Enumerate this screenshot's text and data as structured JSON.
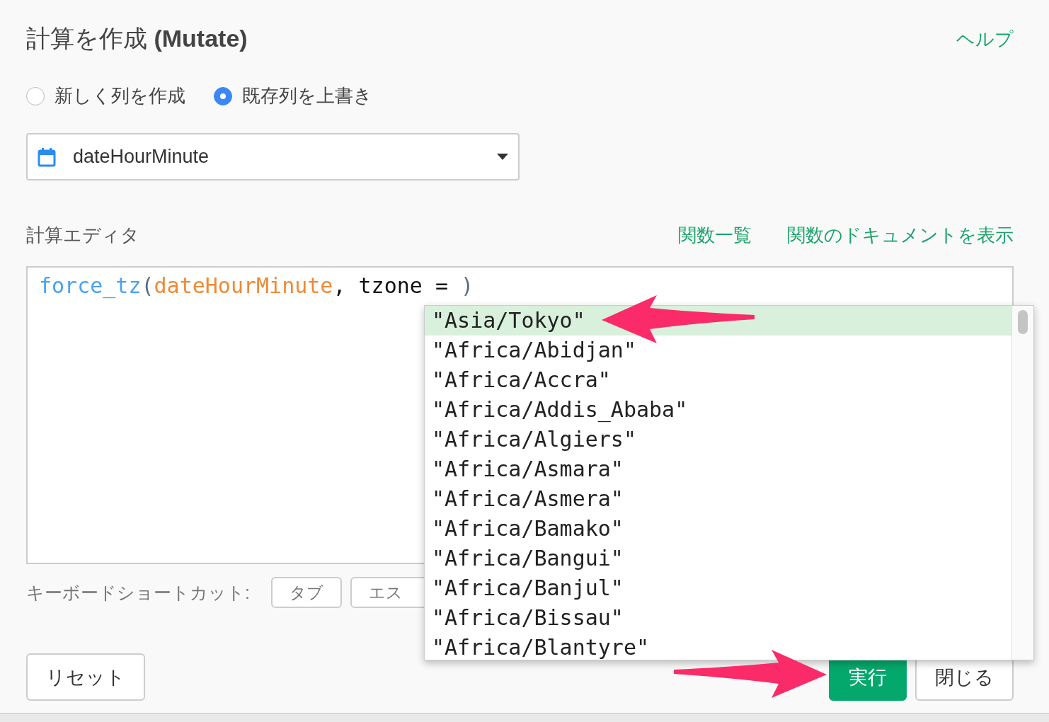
{
  "dialog": {
    "title": "計算を作成",
    "title_suffix": "(Mutate)",
    "help_link": "ヘルプ"
  },
  "mode_options": [
    {
      "label": "新しく列を作成",
      "selected": false
    },
    {
      "label": "既存列を上書き",
      "selected": true
    }
  ],
  "column_select": {
    "value": "dateHourMinute"
  },
  "editor": {
    "label": "計算エディタ",
    "links": [
      "関数一覧",
      "関数のドキュメントを表示"
    ],
    "code": [
      {
        "kind": "function",
        "text": "force_tz"
      },
      {
        "kind": "paren",
        "text": "("
      },
      {
        "kind": "column",
        "text": "dateHourMinute"
      },
      {
        "kind": "plain",
        "text": ", tzone = "
      },
      {
        "kind": "paren",
        "text": ")"
      }
    ]
  },
  "autocomplete": [
    {
      "label": "\"Asia/Tokyo\"",
      "selected": true
    },
    {
      "label": "\"Africa/Abidjan\"",
      "selected": false
    },
    {
      "label": "\"Africa/Accra\"",
      "selected": false
    },
    {
      "label": "\"Africa/Addis_Ababa\"",
      "selected": false
    },
    {
      "label": "\"Africa/Algiers\"",
      "selected": false
    },
    {
      "label": "\"Africa/Asmara\"",
      "selected": false
    },
    {
      "label": "\"Africa/Asmera\"",
      "selected": false
    },
    {
      "label": "\"Africa/Bamako\"",
      "selected": false
    },
    {
      "label": "\"Africa/Bangui\"",
      "selected": false
    },
    {
      "label": "\"Africa/Banjul\"",
      "selected": false
    },
    {
      "label": "\"Africa/Bissau\"",
      "selected": false
    },
    {
      "label": "\"Africa/Blantyre\"",
      "selected": false
    }
  ],
  "shortcuts": {
    "label": "キーボードショートカット:",
    "keys": [
      "タブ",
      "エス"
    ]
  },
  "buttons": {
    "reset": "リセット",
    "run": "実行",
    "close": "閉じる"
  }
}
